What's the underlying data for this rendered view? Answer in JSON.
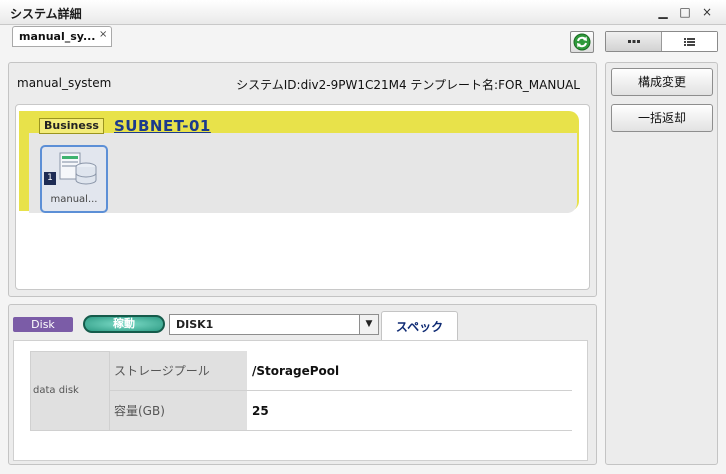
{
  "window": {
    "title": "システム詳細",
    "controls": [
      "▁",
      "□",
      "×"
    ]
  },
  "tabs": [
    {
      "label": "manual_sy...",
      "close": "×"
    }
  ],
  "system": {
    "name": "manual_system",
    "info": "システムID:div2-9PW1C21M4  テンプレート名:FOR_MANUAL"
  },
  "canvas": {
    "subnet": {
      "badge": "Business",
      "name": "SUBNET-01",
      "color": "#e8e24a"
    },
    "server": {
      "count": "1",
      "label": "manual..."
    }
  },
  "right_panel": {
    "buttons": [
      "構成変更",
      "一括返却"
    ]
  },
  "disk": {
    "badge": "Disk",
    "status": "稼動",
    "selected": "DISK1",
    "tab": "スペック",
    "table": {
      "group": "data disk",
      "rows": [
        {
          "label": "ストレージプール",
          "value": "/StoragePool"
        },
        {
          "label": "容量(GB)",
          "value": "25"
        }
      ]
    }
  },
  "icons": {
    "refresh": "refresh-icon",
    "view_dots": "dots-view-icon",
    "view_list": "list-view-icon",
    "server": "server-storage-icon"
  }
}
